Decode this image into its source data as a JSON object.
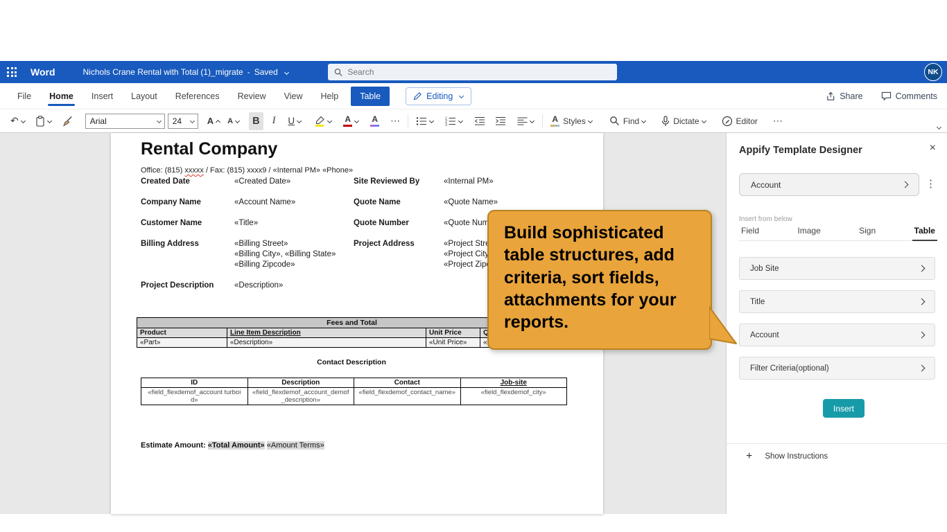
{
  "colors": {
    "titlebar_blue": "#185ABD",
    "callout_bg": "#E9A43C",
    "callout_border": "#BA831E",
    "insert_button_teal": "#189BA9",
    "font_color_red": "#C00000",
    "highlight_yellow": "#F7E300"
  },
  "icons": {
    "undo_arrow": "↶",
    "close_x": "×",
    "kebab_dots": "⋮",
    "plus_sign": "+",
    "more_ellipsis": "⋯"
  },
  "titlebar": {
    "app_name": "Word",
    "doc_title": "Nichols Crane Rental with Total (1)_migrate",
    "saved_separator": "-",
    "saved_status": "Saved",
    "search_placeholder": "Search",
    "avatar_initials": "NK"
  },
  "ribbon": {
    "tabs": [
      {
        "label": "File"
      },
      {
        "label": "Home"
      },
      {
        "label": "Insert"
      },
      {
        "label": "Layout"
      },
      {
        "label": "References"
      },
      {
        "label": "Review"
      },
      {
        "label": "View"
      },
      {
        "label": "Help"
      },
      {
        "label": "Table"
      }
    ],
    "editing_label": "Editing",
    "share_label": "Share",
    "comments_label": "Comments",
    "toolbar": {
      "font_name": "Arial",
      "font_size": "24",
      "bold_glyph": "B",
      "italic_glyph": "I",
      "underline_glyph": "U",
      "grow_font_glyph": "A",
      "shrink_font_glyph": "A",
      "font_color_glyph": "A",
      "text_effects_glyph": "A",
      "styles_glyph": "A",
      "styles_label": "Styles",
      "find_label": "Find",
      "dictate_label": "Dictate",
      "editor_label": "Editor"
    }
  },
  "document": {
    "title": "Rental Company",
    "office_prefix": "Office: (815) ",
    "office_xxxxx": "xxxxx",
    "office_rest": " / Fax: (815) xxxx9 / «Internal PM» «Phone»",
    "info_fields": [
      {
        "l1": "Created Date",
        "v1": "«Created Date»",
        "l2": "Site Reviewed By",
        "v2": "«Internal PM»"
      },
      {
        "l1": "Company Name",
        "v1": "«Account Name»",
        "l2": "Quote Name",
        "v2": "«Quote Name»"
      },
      {
        "l1": "Customer Name",
        "v1": "«Title»",
        "l2": "Quote Number",
        "v2": "«Quote Number»"
      },
      {
        "l1": "Billing Address",
        "v1": "«Billing Street»\n«Billing City», «Billing State»\n«Billing Zipcode»",
        "l2": "Project Address",
        "v2": "«Project Street»\n«Project City», «Project State»\n«Project Zipcode»"
      },
      {
        "l1": "Project Description",
        "v1": "«Description»",
        "l2": "",
        "v2": ""
      }
    ],
    "fees_table": {
      "title": "Fees and Total",
      "headers": [
        "Product",
        "Line Item Description",
        "Unit Price",
        "Qty"
      ],
      "rows": [
        [
          "«Part»",
          "«Description»",
          "«Unit Price»",
          "«Count»"
        ]
      ]
    },
    "contact_heading": "Contact Description",
    "contact_table": {
      "headers": [
        "ID",
        "Description",
        "Contact",
        "Job-site"
      ],
      "rows": [
        [
          "«field_flexdemof_account turboid»",
          "«field_flexdemof_account_demof_description»",
          "«field_flexdemof_contact_name»",
          "«field_flexdemof_city»"
        ]
      ]
    },
    "estimate": {
      "label": "Estimate Amount:",
      "amount": "«Total Amount»",
      "terms": "«Amount Terms»"
    }
  },
  "panel": {
    "title": "Appify Template Designer",
    "selector_value": "Account",
    "insert_from_below": "Insert from below",
    "tabs": [
      {
        "label": "Field"
      },
      {
        "label": "Image"
      },
      {
        "label": "Sign"
      },
      {
        "label": "Table"
      }
    ],
    "items": [
      {
        "label": "Job Site"
      },
      {
        "label": "Title"
      },
      {
        "label": "Account"
      },
      {
        "label": "Filter Criteria(optional)"
      }
    ],
    "insert_button_label": "Insert",
    "show_instructions_label": "Show Instructions"
  },
  "callout": {
    "text": "Build sophisticated table structures, add criteria, sort fields, attachments for your reports."
  }
}
